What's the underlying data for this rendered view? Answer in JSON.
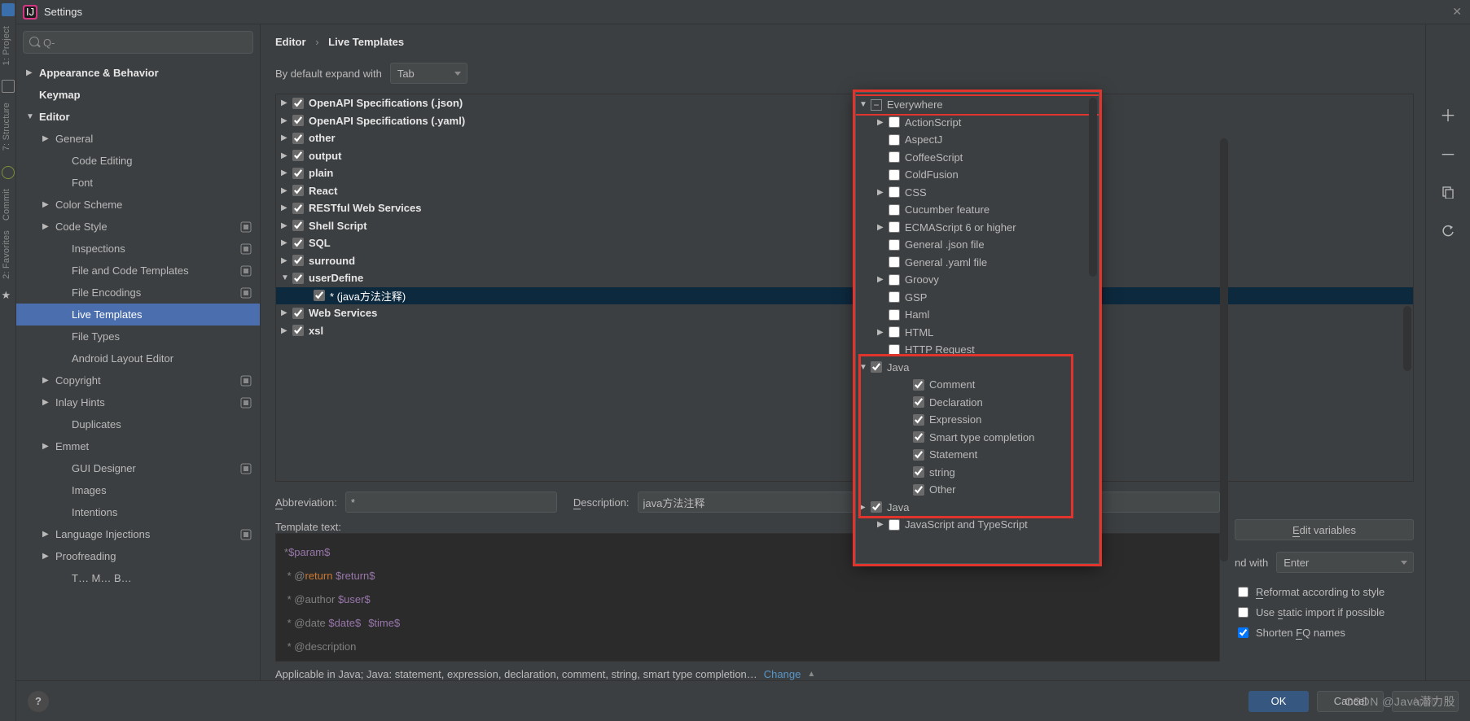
{
  "window": {
    "title": "Settings"
  },
  "vtabs": [
    "1: Project",
    "7: Structure",
    "Commit",
    "2: Favorites"
  ],
  "breadcrumb": {
    "root": "Editor",
    "leaf": "Live Templates"
  },
  "expand": {
    "label": "By default expand with",
    "value": "Tab"
  },
  "sidebar": {
    "search_placeholder": "",
    "items": [
      {
        "label": "Appearance & Behavior",
        "indent": 0,
        "bold": true,
        "arrow": "▶"
      },
      {
        "label": "Keymap",
        "indent": 0,
        "bold": true,
        "arrow": ""
      },
      {
        "label": "Editor",
        "indent": 0,
        "bold": true,
        "arrow": "▼"
      },
      {
        "label": "General",
        "indent": 1,
        "bold": false,
        "arrow": "▶"
      },
      {
        "label": "Code Editing",
        "indent": 2,
        "bold": false,
        "arrow": ""
      },
      {
        "label": "Font",
        "indent": 2,
        "bold": false,
        "arrow": ""
      },
      {
        "label": "Color Scheme",
        "indent": 1,
        "bold": false,
        "arrow": "▶"
      },
      {
        "label": "Code Style",
        "indent": 1,
        "bold": false,
        "arrow": "▶",
        "badge": true
      },
      {
        "label": "Inspections",
        "indent": 2,
        "bold": false,
        "arrow": "",
        "badge": true
      },
      {
        "label": "File and Code Templates",
        "indent": 2,
        "bold": false,
        "arrow": "",
        "badge": true
      },
      {
        "label": "File Encodings",
        "indent": 2,
        "bold": false,
        "arrow": "",
        "badge": true
      },
      {
        "label": "Live Templates",
        "indent": 2,
        "bold": false,
        "arrow": "",
        "selected": true
      },
      {
        "label": "File Types",
        "indent": 2,
        "bold": false,
        "arrow": ""
      },
      {
        "label": "Android Layout Editor",
        "indent": 2,
        "bold": false,
        "arrow": ""
      },
      {
        "label": "Copyright",
        "indent": 1,
        "bold": false,
        "arrow": "▶",
        "badge": true
      },
      {
        "label": "Inlay Hints",
        "indent": 1,
        "bold": false,
        "arrow": "▶",
        "badge": true
      },
      {
        "label": "Duplicates",
        "indent": 2,
        "bold": false,
        "arrow": ""
      },
      {
        "label": "Emmet",
        "indent": 1,
        "bold": false,
        "arrow": "▶"
      },
      {
        "label": "GUI Designer",
        "indent": 2,
        "bold": false,
        "arrow": "",
        "badge": true
      },
      {
        "label": "Images",
        "indent": 2,
        "bold": false,
        "arrow": ""
      },
      {
        "label": "Intentions",
        "indent": 2,
        "bold": false,
        "arrow": ""
      },
      {
        "label": "Language Injections",
        "indent": 1,
        "bold": false,
        "arrow": "▶",
        "badge": true
      },
      {
        "label": "Proofreading",
        "indent": 1,
        "bold": false,
        "arrow": "▶"
      },
      {
        "label": "T… M… B…",
        "indent": 2,
        "bold": false,
        "arrow": "",
        "cut": true
      }
    ]
  },
  "templates": [
    {
      "label": "OpenAPI Specifications (.json)",
      "arrow": "▶"
    },
    {
      "label": "OpenAPI Specifications (.yaml)",
      "arrow": "▶"
    },
    {
      "label": "other",
      "arrow": "▶"
    },
    {
      "label": "output",
      "arrow": "▶"
    },
    {
      "label": "plain",
      "arrow": "▶"
    },
    {
      "label": "React",
      "arrow": "▶"
    },
    {
      "label": "RESTful Web Services",
      "arrow": "▶"
    },
    {
      "label": "Shell Script",
      "arrow": "▶"
    },
    {
      "label": "SQL",
      "arrow": "▶"
    },
    {
      "label": "surround",
      "arrow": "▶"
    },
    {
      "label": "userDefine",
      "arrow": "▼",
      "expanded": true,
      "child": {
        "label": "* (java方法注释)",
        "selected": true
      }
    },
    {
      "label": "Web Services",
      "arrow": "▶"
    },
    {
      "label": "xsl",
      "arrow": "▶"
    }
  ],
  "detail": {
    "abbrev_label": "Abbreviation:",
    "abbrev": "*",
    "desc_label": "Description:",
    "desc": "java方法注释",
    "text_label": "Template text:",
    "edit_vars": "Edit variables",
    "expand_with_label": "nd with",
    "expand_with_value": "Enter",
    "reformat": "Reformat according to style",
    "static_import": "Use static import if possible",
    "shorten_fq": "Shorten FQ names",
    "applicable": "Applicable in Java; Java: statement, expression, declaration, comment, string, smart type completion…",
    "change": "Change",
    "code_lines": [
      {
        "type": "id",
        "pre": "*",
        "t": "$param$"
      },
      {
        "type": "ret",
        "pre": " * @",
        "kw": "return",
        "sp": " ",
        "id": "$return$"
      },
      {
        "type": "plain",
        "pre": " * @author ",
        "id": "$user$"
      },
      {
        "type": "plain2",
        "pre": " * @date ",
        "id": "$date$",
        "sp": " ",
        "id2": "$time$"
      },
      {
        "type": "plain",
        "pre": " * @description",
        "id": ""
      }
    ]
  },
  "popup": {
    "root": {
      "label": "Everywhere",
      "state": "minus"
    },
    "items": [
      {
        "label": "ActionScript",
        "indent": 1,
        "arrow": "▶"
      },
      {
        "label": "AspectJ",
        "indent": 1
      },
      {
        "label": "CoffeeScript",
        "indent": 1
      },
      {
        "label": "ColdFusion",
        "indent": 1
      },
      {
        "label": "CSS",
        "indent": 1,
        "arrow": "▶"
      },
      {
        "label": "Cucumber feature",
        "indent": 1
      },
      {
        "label": "ECMAScript 6 or higher",
        "indent": 1,
        "arrow": "▶"
      },
      {
        "label": "General .json file",
        "indent": 1
      },
      {
        "label": "General .yaml file",
        "indent": 1
      },
      {
        "label": "Groovy",
        "indent": 1,
        "arrow": "▶"
      },
      {
        "label": "GSP",
        "indent": 1
      },
      {
        "label": "Haml",
        "indent": 1
      },
      {
        "label": "HTML",
        "indent": 1,
        "arrow": "▶"
      },
      {
        "label": "HTTP Request",
        "indent": 1
      },
      {
        "label": "Java",
        "indent": 0,
        "arrow": "▼",
        "checked": true,
        "hl": true
      },
      {
        "label": "Comment",
        "indent": 2,
        "checked": true
      },
      {
        "label": "Declaration",
        "indent": 2,
        "checked": true
      },
      {
        "label": "Expression",
        "indent": 2,
        "checked": true
      },
      {
        "label": "Smart type completion",
        "indent": 2,
        "checked": true
      },
      {
        "label": "Statement",
        "indent": 2,
        "checked": true
      },
      {
        "label": "string",
        "indent": 2,
        "checked": true
      },
      {
        "label": "Other",
        "indent": 2,
        "checked": true
      },
      {
        "label": "Java",
        "indent": 0,
        "arrow": "▶",
        "checked": true
      },
      {
        "label": "JavaScript and TypeScript",
        "indent": 1,
        "arrow": "▶"
      }
    ]
  },
  "buttons": {
    "ok": "OK",
    "cancel": "Cancel",
    "apply": "Apply"
  },
  "watermark": "CSDN @Java潜力股"
}
